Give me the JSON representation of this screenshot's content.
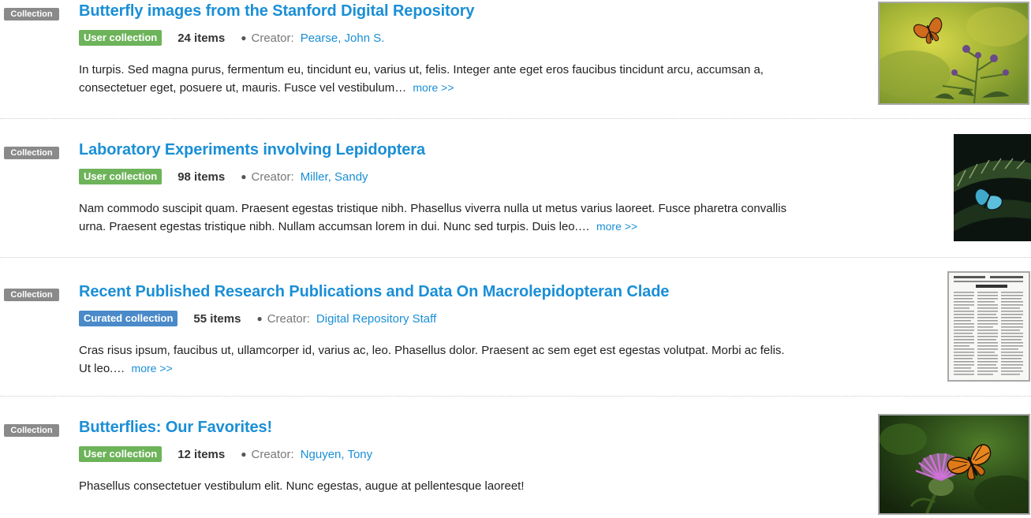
{
  "results": [
    {
      "type_label": "Collection",
      "title": "Butterfly images from the Stanford Digital Repository",
      "collection_label": "User collection",
      "collection_kind": "user",
      "count": "24 items",
      "creator_label": "Creator:",
      "creator": "Pearse, John S.",
      "description": "In turpis. Sed magna purus, fermentum eu, tincidunt eu, varius ut, felis. Integer ante eget eros faucibus tincidunt arcu, accumsan a, consectetuer eget, posuere ut, mauris. Fusce vel vestibulum…",
      "more": "more >>"
    },
    {
      "type_label": "Collection",
      "title": "Laboratory Experiments involving Lepidoptera",
      "collection_label": "User collection",
      "collection_kind": "user",
      "count": "98 items",
      "creator_label": "Creator:",
      "creator": "Miller, Sandy",
      "description": "Nam commodo suscipit quam. Praesent egestas tristique nibh. Phasellus viverra nulla ut metus varius laoreet. Fusce pharetra convallis urna. Praesent egestas tristique nibh. Nullam accumsan lorem in dui. Nunc sed turpis. Duis leo.…",
      "more": "more >>"
    },
    {
      "type_label": "Collection",
      "title": "Recent Published Research Publications and Data On Macrolepidopteran Clade",
      "collection_label": "Curated collection",
      "collection_kind": "curated",
      "count": "55 items",
      "creator_label": "Creator:",
      "creator": "Digital Repository Staff",
      "description": "Cras risus ipsum, faucibus ut, ullamcorper id, varius ac, leo. Phasellus dolor. Praesent ac sem eget est egestas volutpat. Morbi ac felis. Ut leo.…",
      "more": "more >>"
    },
    {
      "type_label": "Collection",
      "title": "Butterflies: Our Favorites!",
      "collection_label": "User collection",
      "collection_kind": "user",
      "count": "12 items",
      "creator_label": "Creator:",
      "creator": "Nguyen, Tony",
      "description": "Phasellus consectetuer vestibulum elit. Nunc egestas, augue at pellentesque laoreet!",
      "more": ""
    }
  ],
  "colors": {
    "link": "#1a8fd6",
    "user_collection": "#6db35a",
    "curated_collection": "#4a8ac9",
    "type_badge": "#8a8a8a"
  }
}
